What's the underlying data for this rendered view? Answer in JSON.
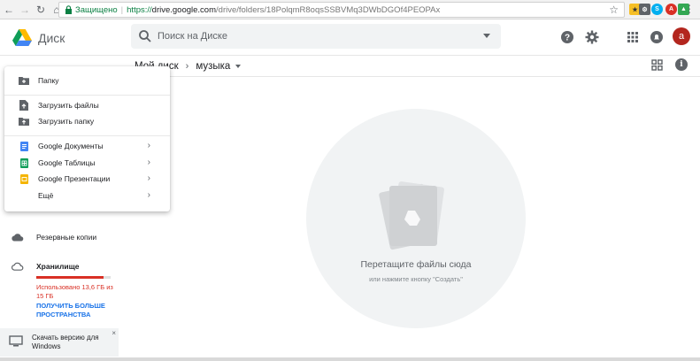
{
  "browser": {
    "secure_label": "Защищено",
    "url_proto": "https://",
    "url_host": "drive.google.com",
    "url_path": "/drive/folders/18PolqmR8oqsSSBVMq3DWbDGOf4PEOPAx"
  },
  "header": {
    "brand": "Диск",
    "search_placeholder": "Поиск на Диске",
    "avatar_letter": "a"
  },
  "breadcrumb": {
    "parent": "Мой диск",
    "current": "музыка"
  },
  "new_menu": {
    "items": [
      {
        "label": "Папку",
        "icon": "folder-plus-icon"
      },
      {
        "label": "Загрузить файлы",
        "icon": "file-upload-icon"
      },
      {
        "label": "Загрузить папку",
        "icon": "folder-upload-icon"
      },
      {
        "label": "Google Документы",
        "icon": "docs-icon",
        "color": "#4285f4"
      },
      {
        "label": "Google Таблицы",
        "icon": "sheets-icon",
        "color": "#0f9d58"
      },
      {
        "label": "Google Презентации",
        "icon": "slides-icon",
        "color": "#f4b400"
      },
      {
        "label": "Ещё",
        "icon": ""
      }
    ]
  },
  "sidebar": {
    "backups": "Резервные копии",
    "storage_title": "Хранилище",
    "storage_used": "Использовано 13,6 ГБ из 15 ГБ",
    "storage_fraction": 0.907,
    "upgrade_link": "ПОЛУЧИТЬ БОЛЬШЕ ПРОСТРАНСТВА",
    "download_text": "Скачать версию для Windows",
    "close_glyph": "×"
  },
  "empty_state": {
    "title": "Перетащите файлы сюда",
    "subtitle": "или нажмите кнопку \"Создать\""
  },
  "colors": {
    "accent_red": "#d93025",
    "link_blue": "#1a73e8",
    "avatar": "#b3261e"
  }
}
